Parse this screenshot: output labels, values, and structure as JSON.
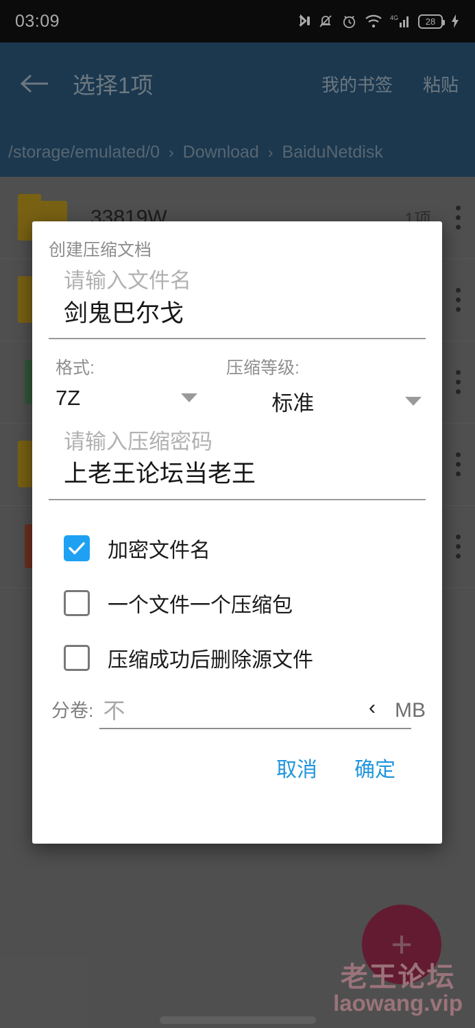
{
  "statusbar": {
    "time": "03:09",
    "battery_level": "28",
    "icons": [
      "bluetooth-icon",
      "mute-icon",
      "alarm-icon",
      "wifi-icon",
      "4g-signal-icon",
      "battery-icon",
      "charging-bolt-icon"
    ],
    "network_label": "4G"
  },
  "appbar": {
    "back_icon": "back-arrow-icon",
    "title": "选择1项",
    "bookmarks_label": "我的书签",
    "paste_label": "粘贴",
    "background_color": "#1a4a6e"
  },
  "breadcrumb": {
    "separator": "›",
    "segments": [
      "/storage/emulated/0",
      "Download",
      "BaiduNetdisk"
    ]
  },
  "filelist": {
    "rows": [
      {
        "name": "33819W",
        "meta": "1项",
        "icon": "folder-icon",
        "icon_color": "#b08c0d"
      },
      {
        "name": "",
        "meta": "",
        "icon": "folder-icon",
        "icon_color": "#b08c0d"
      },
      {
        "name": "",
        "meta": "",
        "icon": "file-icon",
        "icon_color": "#3f7a4a"
      },
      {
        "name": "",
        "meta": "",
        "icon": "folder-icon",
        "icon_color": "#b08c0d"
      },
      {
        "name": "",
        "meta": "",
        "icon": "file-icon",
        "icon_color": "#9e3b22"
      }
    ],
    "overflow_icon": "more-vertical-icon"
  },
  "fab": {
    "label": "+",
    "color": "#8e1a3f"
  },
  "watermark": {
    "line1": "老王论坛",
    "line2": "laowang.vip",
    "color": "#e7a8b4"
  },
  "dialog": {
    "title": "创建压缩文档",
    "filename": {
      "hint": "请输入文件名",
      "value": "剑鬼巴尔戈"
    },
    "format": {
      "label": "格式:",
      "value": "7Z",
      "caret_icon": "chevron-down-icon"
    },
    "level": {
      "label": "压缩等级:",
      "value": "标准",
      "caret_icon": "chevron-down-icon"
    },
    "password": {
      "hint": "请输入压缩密码",
      "value": "上老王论坛当老王"
    },
    "checkboxes": [
      {
        "label": "加密文件名",
        "checked": true
      },
      {
        "label": "一个文件一个压缩包",
        "checked": false
      },
      {
        "label": "压缩成功后删除源文件",
        "checked": false
      }
    ],
    "volume": {
      "label": "分卷:",
      "hint": "不",
      "chevron": "‹",
      "unit": "MB"
    },
    "cancel_label": "取消",
    "ok_label": "确定",
    "accent_color": "#2196dd",
    "checkbox_on_color": "#1ea1f2"
  }
}
